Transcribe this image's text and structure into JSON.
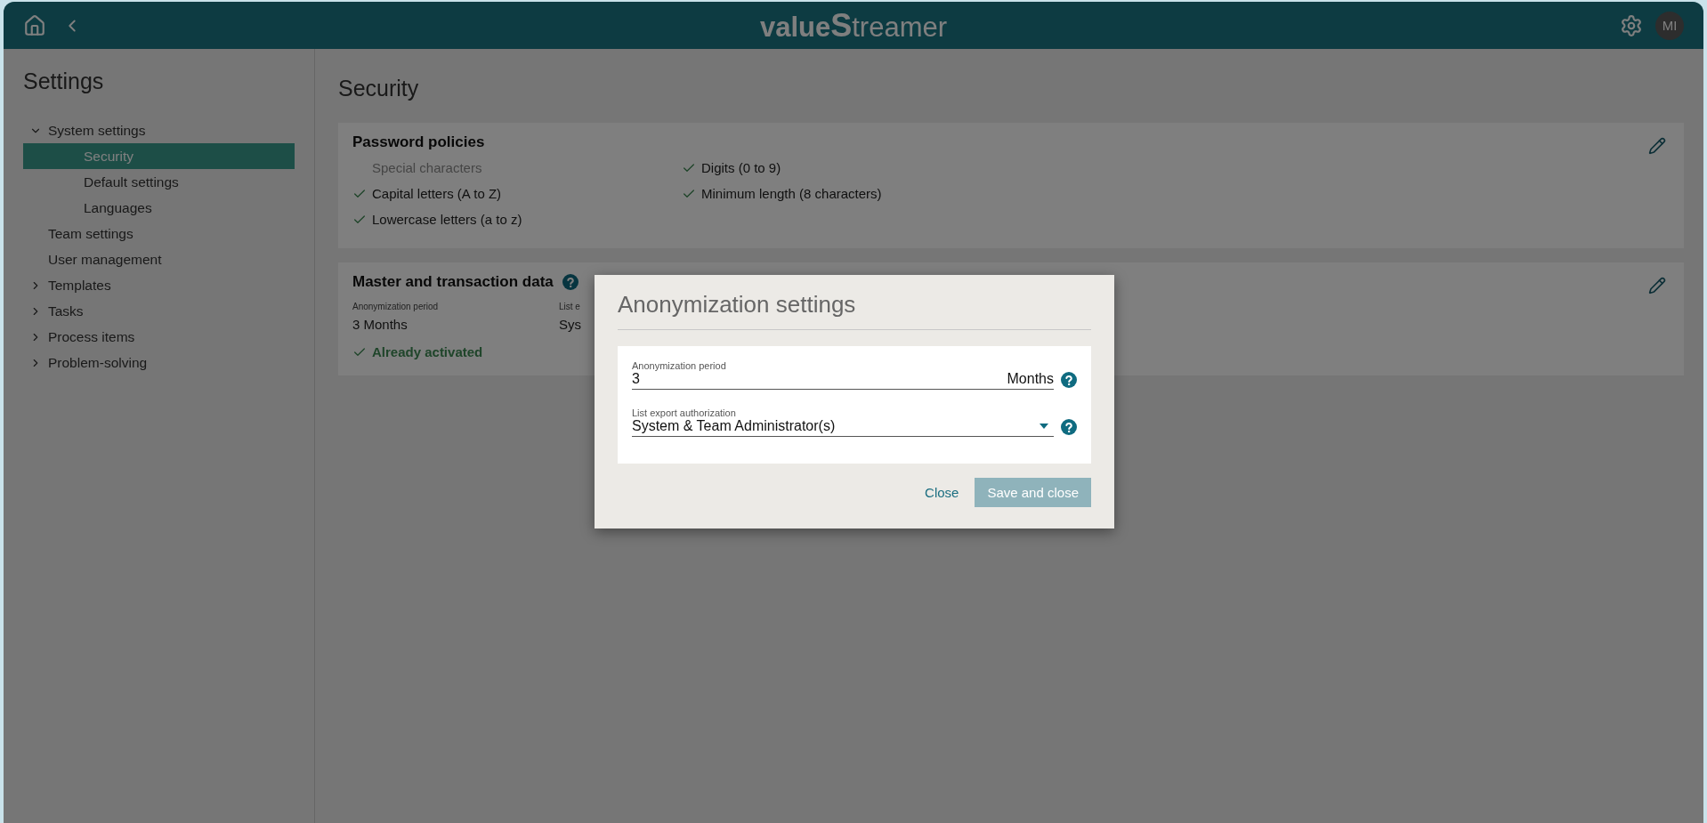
{
  "header": {
    "logo": {
      "left": "value",
      "mark": "S",
      "right": "treamer"
    },
    "avatar": "MI"
  },
  "sidebar": {
    "title": "Settings",
    "items": [
      {
        "label": "System settings",
        "expanded": true,
        "selected": false,
        "children": [
          {
            "label": "Security",
            "selected": true
          },
          {
            "label": "Default settings",
            "selected": false
          },
          {
            "label": "Languages",
            "selected": false
          }
        ]
      },
      {
        "label": "Team settings",
        "selected": false
      },
      {
        "label": "User management",
        "selected": false
      },
      {
        "label": "Templates",
        "expanded": false,
        "selected": false
      },
      {
        "label": "Tasks",
        "expanded": false,
        "selected": false
      },
      {
        "label": "Process items",
        "expanded": false,
        "selected": false
      },
      {
        "label": "Problem-solving",
        "expanded": false,
        "selected": false
      }
    ]
  },
  "page": {
    "title": "Security",
    "password_card": {
      "title": "Password policies",
      "rules": [
        {
          "label": "Special characters",
          "checked": false
        },
        {
          "label": "Capital letters (A to Z)",
          "checked": true
        },
        {
          "label": "Lowercase letters (a to z)",
          "checked": true
        },
        {
          "label": "Digits (0 to 9)",
          "checked": true
        },
        {
          "label": "Minimum length (8 characters)",
          "checked": true
        }
      ]
    },
    "master_card": {
      "title": "Master and transaction data",
      "fields": [
        {
          "label": "Anonymization period",
          "value": "3 Months"
        },
        {
          "label": "List e",
          "value": "Sys"
        }
      ],
      "status": "Already activated"
    }
  },
  "dialog": {
    "title": "Anonymization settings",
    "fields": [
      {
        "kind": "number",
        "label": "Anonymization period",
        "value": "3",
        "unit": "Months"
      },
      {
        "kind": "select",
        "label": "List export authorization",
        "value": "System & Team Administrator(s)"
      }
    ],
    "buttons": [
      {
        "label": "Close",
        "kind": "link",
        "disabled": false
      },
      {
        "label": "Save and close",
        "kind": "primary",
        "disabled": true
      }
    ]
  }
}
